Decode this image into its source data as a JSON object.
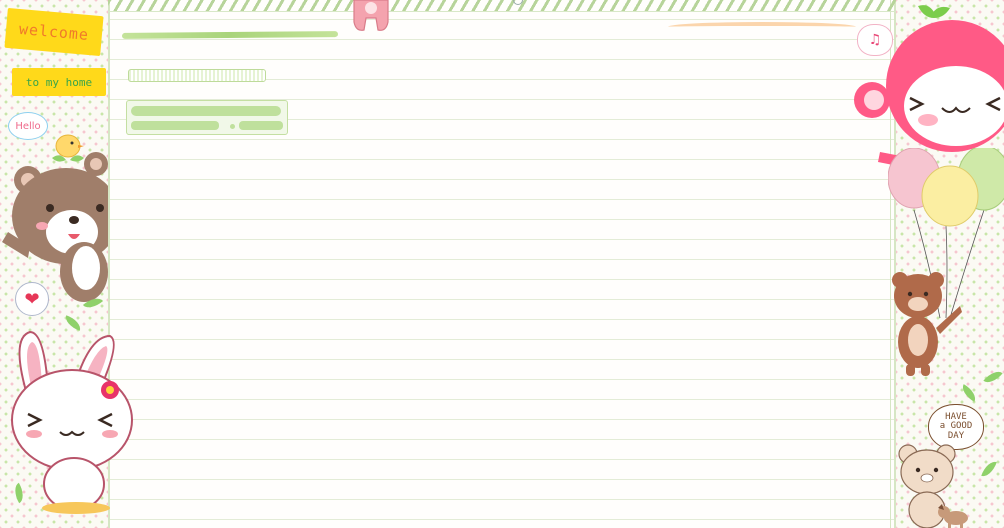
{
  "sidebar_left": {
    "welcome_label": "welcome",
    "home_label": "to my home",
    "hello_label": "Hello",
    "heart_symbol": "❤"
  },
  "sidebar_right": {
    "note_symbol": "♫",
    "good_day_lines": [
      "HAVE",
      "a GOOD",
      "DAY"
    ]
  },
  "colors": {
    "accent_yellow": "#ffd91a",
    "accent_green": "#bfe09c",
    "accent_pink": "#ff5a86",
    "bear_brown": "#a07e6a"
  },
  "icons": [
    "chick-icon",
    "bear-icon",
    "bunny-icon",
    "monkey-icon",
    "balloon-icon",
    "dog-icon",
    "heart-icon",
    "music-note-icon"
  ]
}
